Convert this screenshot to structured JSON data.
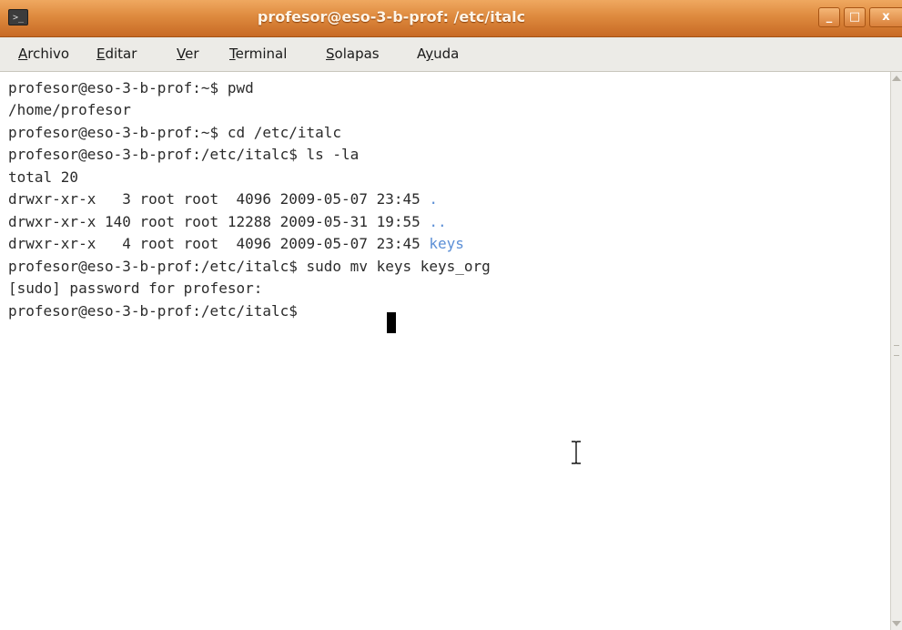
{
  "window": {
    "title": "profesor@eso-3-b-prof: /etc/italc",
    "icon": "terminal-icon",
    "controls": {
      "minimize_glyph": "_",
      "maximize_glyph": "□",
      "close_glyph": "x"
    }
  },
  "menu": [
    {
      "mnemonic": "A",
      "rest": "rchivo"
    },
    {
      "mnemonic": "E",
      "rest": "ditar"
    },
    {
      "mnemonic": "V",
      "rest": "er"
    },
    {
      "mnemonic": "T",
      "rest": "erminal"
    },
    {
      "mnemonic": "S",
      "rest": "olapas"
    },
    {
      "pre": "A",
      "mnemonic": "y",
      "rest": "uda"
    }
  ],
  "terminal": {
    "lines": [
      "profesor@eso-3-b-prof:~$ pwd",
      "/home/profesor",
      "profesor@eso-3-b-prof:~$ cd /etc/italc",
      "profesor@eso-3-b-prof:/etc/italc$ ls -la",
      "total 20",
      {
        "text": "drwxr-xr-x   3 root root  4096 2009-05-07 23:45 ",
        "name": "."
      },
      {
        "text": "drwxr-xr-x 140 root root 12288 2009-05-31 19:55 ",
        "name": ".."
      },
      {
        "text": "drwxr-xr-x   4 root root  4096 2009-05-07 23:45 ",
        "name": "keys"
      },
      "profesor@eso-3-b-prof:/etc/italc$ sudo mv keys keys_org",
      "[sudo] password for profesor:",
      "profesor@eso-3-b-prof:/etc/italc$ "
    ]
  },
  "colors": {
    "titlebar": "#de8a3e",
    "directory": "#5c8fd6",
    "text": "#2b2b2b",
    "menubar": "#ecebe7"
  }
}
